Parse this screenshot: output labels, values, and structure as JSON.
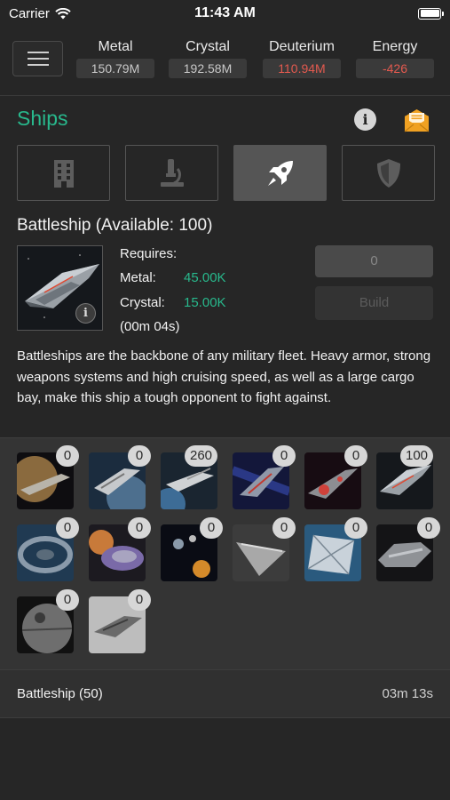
{
  "status_bar": {
    "carrier": "Carrier",
    "time": "11:43 AM"
  },
  "resources": [
    {
      "label": "Metal",
      "value": "150.79M",
      "negative": false
    },
    {
      "label": "Crystal",
      "value": "192.58M",
      "negative": false
    },
    {
      "label": "Deuterium",
      "value": "110.94M",
      "negative": true
    },
    {
      "label": "Energy",
      "value": "-426",
      "negative": true
    }
  ],
  "section": {
    "title": "Ships"
  },
  "tabs": [
    {
      "icon": "building-icon",
      "active": false
    },
    {
      "icon": "microscope-icon",
      "active": false
    },
    {
      "icon": "rocket-icon",
      "active": true
    },
    {
      "icon": "shield-icon",
      "active": false
    }
  ],
  "detail": {
    "title": "Battleship (Available: 100)",
    "requires_label": "Requires:",
    "metal_label": "Metal:",
    "metal_value": "45.00K",
    "crystal_label": "Crystal:",
    "crystal_value": "15.00K",
    "time": "(00m 04s)",
    "quantity_placeholder": "0",
    "build_label": "Build",
    "description": "Battleships are the backbone of any military fleet. Heavy armor, strong weapons systems and high cruising speed, as well as a large cargo bay, make this ship a tough opponent to fight against."
  },
  "ships": [
    {
      "name": "small-cargo",
      "count": "0"
    },
    {
      "name": "large-cargo",
      "count": "0"
    },
    {
      "name": "light-fighter",
      "count": "260"
    },
    {
      "name": "heavy-fighter",
      "count": "0"
    },
    {
      "name": "cruiser",
      "count": "0"
    },
    {
      "name": "battleship",
      "count": "100"
    },
    {
      "name": "colony-ship",
      "count": "0"
    },
    {
      "name": "recycler",
      "count": "0"
    },
    {
      "name": "espionage-probe",
      "count": "0"
    },
    {
      "name": "bomber",
      "count": "0"
    },
    {
      "name": "solar-satellite",
      "count": "0"
    },
    {
      "name": "destroyer",
      "count": "0"
    },
    {
      "name": "deathstar",
      "count": "0"
    },
    {
      "name": "battlecruiser",
      "count": "0"
    }
  ],
  "queue": {
    "name": "Battleship (50)",
    "time": "03m 13s"
  },
  "colors": {
    "accent": "#28b88c",
    "negative": "#e45a4f",
    "mail": "#f0a122"
  }
}
